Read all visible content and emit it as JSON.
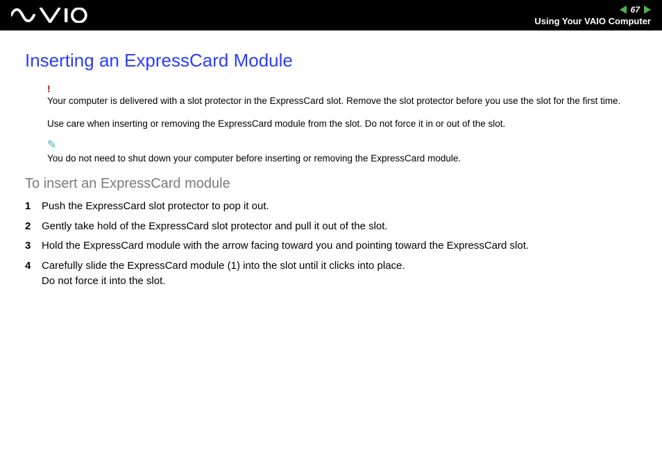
{
  "header": {
    "page_number": "67",
    "section": "Using Your VAIO Computer"
  },
  "title": "Inserting an ExpressCard Module",
  "warning": {
    "icon_label": "!",
    "text": "Your computer is delivered with a slot protector in the ExpressCard slot. Remove the slot protector before you use the slot for the first time."
  },
  "caution_text": "Use care when inserting or removing the ExpressCard module from the slot. Do not force it in or out of the slot.",
  "tip": {
    "icon_label": "✎",
    "text": "You do not need to shut down your computer before inserting or removing the ExpressCard module."
  },
  "subtitle": "To insert an ExpressCard module",
  "steps": [
    {
      "num": "1",
      "text": "Push the ExpressCard slot protector to pop it out."
    },
    {
      "num": "2",
      "text": "Gently take hold of the ExpressCard slot protector and pull it out of the slot."
    },
    {
      "num": "3",
      "text": "Hold the ExpressCard module with the arrow facing toward you and pointing toward the ExpressCard slot."
    },
    {
      "num": "4",
      "text": "Carefully slide the ExpressCard module (1) into the slot until it clicks into place.\nDo not force it into the slot."
    }
  ]
}
